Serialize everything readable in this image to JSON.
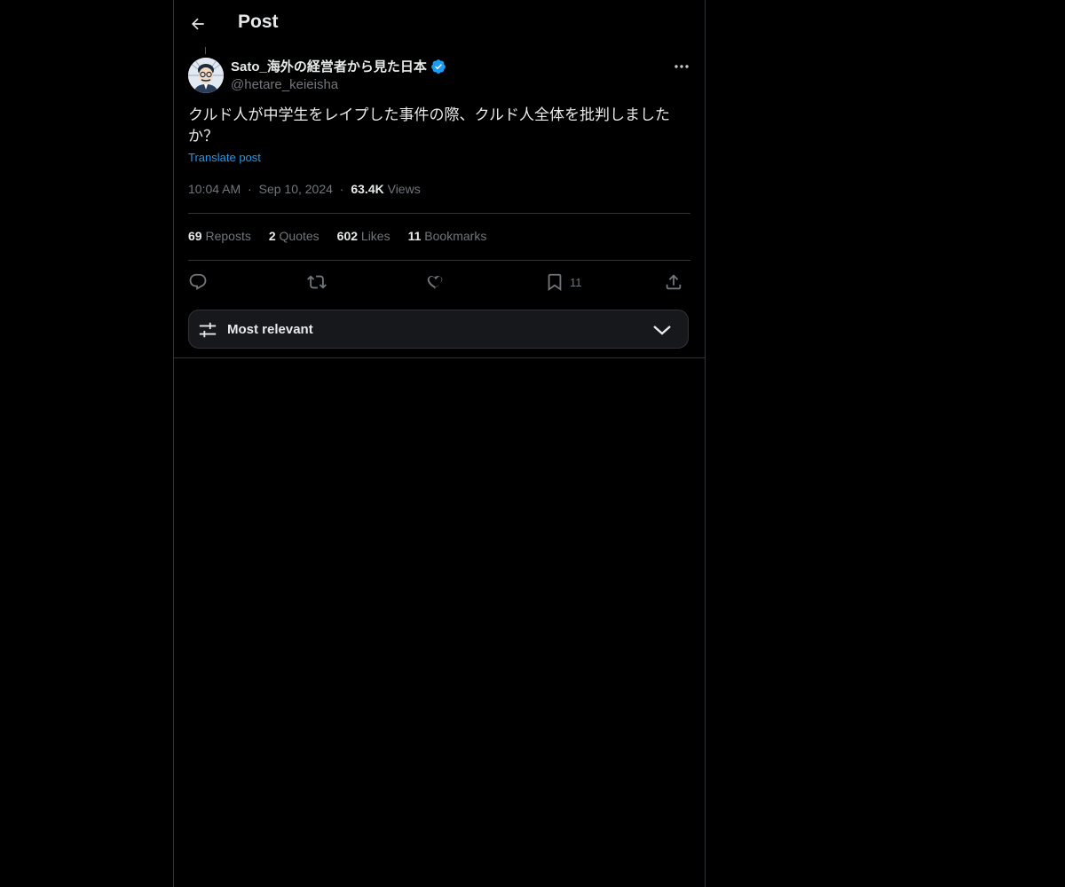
{
  "header": {
    "title": "Post"
  },
  "post": {
    "author": {
      "display_name": "Sato_海外の経営者から見た日本",
      "handle": "@hetare_keieisha",
      "verified": true
    },
    "text": "クルド人が中学生をレイプした事件の際、クルド人全体を批判しましたか？",
    "translate_label": "Translate post",
    "time": "10:04 AM",
    "date": "Sep 10, 2024",
    "separator": "·",
    "views_count": "63.4K",
    "views_label": "Views"
  },
  "stats": {
    "reposts": {
      "count": "69",
      "label": "Reposts"
    },
    "quotes": {
      "count": "2",
      "label": "Quotes"
    },
    "likes": {
      "count": "602",
      "label": "Likes"
    },
    "bookmarks": {
      "count": "11",
      "label": "Bookmarks"
    }
  },
  "actions": {
    "reply": {
      "icon": "reply-icon"
    },
    "repost": {
      "icon": "repost-icon"
    },
    "like": {
      "icon": "heart-icon"
    },
    "bookmark": {
      "icon": "bookmark-icon",
      "count": "11"
    },
    "share": {
      "icon": "share-icon"
    }
  },
  "sort": {
    "label": "Most relevant"
  },
  "colors": {
    "background": "#000000",
    "text": "#e7e9ea",
    "muted": "#71767b",
    "accent": "#1d9bf0",
    "border": "#2f3336"
  }
}
